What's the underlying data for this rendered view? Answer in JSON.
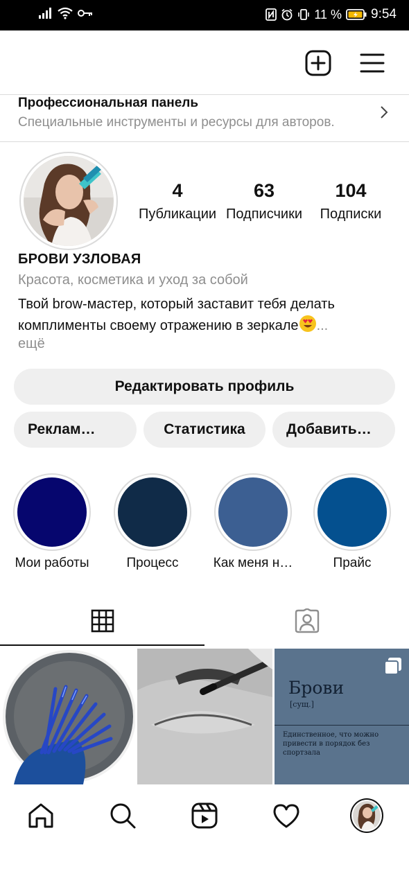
{
  "status_bar": {
    "battery": "11 %",
    "time": "9:54"
  },
  "header": {
    "add_icon": "plus-square-icon",
    "menu_icon": "hamburger-menu-icon"
  },
  "pro_panel": {
    "title": "Профессиональная панель",
    "subtitle": "Специальные инструменты и ресурсы для авторов."
  },
  "profile": {
    "stats": [
      {
        "value": "4",
        "label": "Публикации"
      },
      {
        "value": "63",
        "label": "Подписчики"
      },
      {
        "value": "104",
        "label": "Подписки"
      }
    ],
    "name": "БРОВИ УЗЛОВАЯ",
    "category": "Красота, косметика и уход за собой",
    "bio_line1": "Твой brow-мастер, который заставит тебя делать",
    "bio_line2": "комплименты своему отражению в зеркале",
    "bio_ellipsis": "...",
    "more": "ещё"
  },
  "buttons": {
    "edit_profile": "Редактировать профиль",
    "ads": "Реклам…",
    "stats": "Статистика",
    "add": "Добавить…"
  },
  "highlights": [
    {
      "label": "Мои работы",
      "color": "#06066e"
    },
    {
      "label": "Процесс",
      "color": "#102b48"
    },
    {
      "label": "Как меня н…",
      "color": "#3c5f92"
    },
    {
      "label": "Прайс",
      "color": "#04508f"
    }
  ],
  "tabs": {
    "grid_icon": "grid-icon",
    "tagged_icon": "tagged-person-icon"
  },
  "posts": {
    "post3_title": "Брови",
    "post3_sub": "[сущ.]",
    "post3_desc": "Единственное, что можно привести в порядок без спортзала"
  },
  "bottom_nav": [
    "home-icon",
    "search-icon",
    "reels-icon",
    "heart-icon",
    "profile-avatar"
  ]
}
